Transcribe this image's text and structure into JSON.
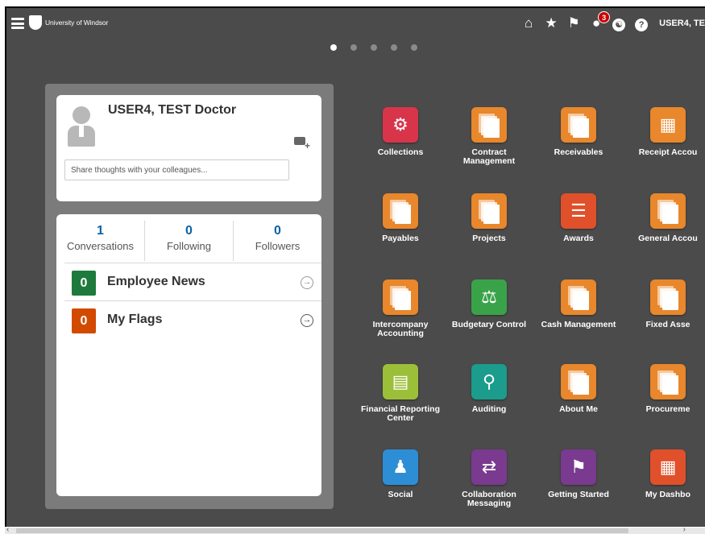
{
  "header": {
    "logo_text": "University of Windsor",
    "user": "USER4, TE",
    "notifications_count": "3",
    "help_glyph": "?",
    "icons": [
      "hamburger-icon",
      "home-icon",
      "star-icon",
      "flag-icon",
      "bell-icon",
      "accessibility-icon",
      "help-icon"
    ]
  },
  "pager": {
    "count": 5,
    "active": 0
  },
  "profile": {
    "name": "USER4, TEST Doctor",
    "share_placeholder": "Share thoughts with your colleagues..."
  },
  "stats": [
    {
      "value": "1",
      "label": "Conversations"
    },
    {
      "value": "0",
      "label": "Following"
    },
    {
      "value": "0",
      "label": "Followers"
    }
  ],
  "news": [
    {
      "count": "0",
      "title": "Employee News",
      "color": "#1e7a3c"
    },
    {
      "count": "0",
      "title": "My Flags",
      "color": "#d24a00"
    }
  ],
  "apps": [
    {
      "label": "Collections",
      "color": "#d8354b",
      "icon": "collections-icon"
    },
    {
      "label": "Contract Management",
      "color": "#e8872c",
      "icon": "stack-icon"
    },
    {
      "label": "Receivables",
      "color": "#e8872c",
      "icon": "stack-icon"
    },
    {
      "label": "Receipt Accou",
      "color": "#e8872c",
      "icon": "receipt-icon"
    },
    {
      "label": "Payables",
      "color": "#e8872c",
      "icon": "stack-icon"
    },
    {
      "label": "Projects",
      "color": "#e8872c",
      "icon": "stack-icon"
    },
    {
      "label": "Awards",
      "color": "#e0502a",
      "icon": "scroll-icon"
    },
    {
      "label": "General Accou",
      "color": "#e8872c",
      "icon": "stack-icon"
    },
    {
      "label": "Intercompany Accounting",
      "color": "#e8872c",
      "icon": "stack-icon"
    },
    {
      "label": "Budgetary Control",
      "color": "#3aa34a",
      "icon": "scales-icon"
    },
    {
      "label": "Cash Management",
      "color": "#e8872c",
      "icon": "stack-icon"
    },
    {
      "label": "Fixed Asse",
      "color": "#e8872c",
      "icon": "stack-icon"
    },
    {
      "label": "Financial Reporting Center",
      "color": "#9cbf3a",
      "icon": "report-icon"
    },
    {
      "label": "Auditing",
      "color": "#1b9c8c",
      "icon": "audit-icon"
    },
    {
      "label": "About Me",
      "color": "#e8872c",
      "icon": "stack-icon"
    },
    {
      "label": "Procureme",
      "color": "#e8872c",
      "icon": "stack-icon"
    },
    {
      "label": "Social",
      "color": "#2d8ed6",
      "icon": "social-icon"
    },
    {
      "label": "Collaboration Messaging",
      "color": "#7a3a8f",
      "icon": "exchange-icon"
    },
    {
      "label": "Getting Started",
      "color": "#7a3a8f",
      "icon": "flag-icon"
    },
    {
      "label": "My Dashbo",
      "color": "#e0502a",
      "icon": "dashboard-icon"
    }
  ]
}
